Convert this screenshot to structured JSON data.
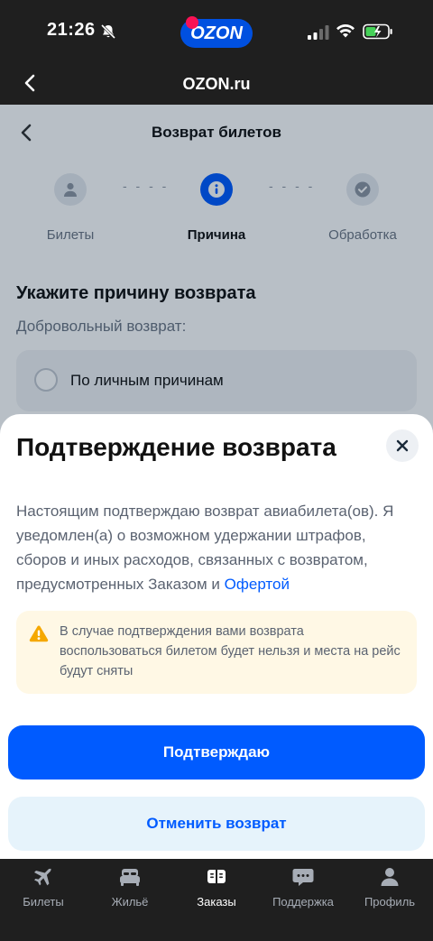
{
  "status_bar": {
    "time": "21:26",
    "app_logo": "OZON"
  },
  "browser": {
    "title": "OZON.ru"
  },
  "page": {
    "title": "Возврат билетов",
    "steps": [
      {
        "label": "Билеты",
        "icon": "user-icon",
        "state": "done"
      },
      {
        "label": "Причина",
        "icon": "info-icon",
        "state": "active"
      },
      {
        "label": "Обработка",
        "icon": "check-icon",
        "state": "pending"
      }
    ],
    "reason": {
      "title": "Укажите причину возврата",
      "subtitle": "Добровольный возврат:",
      "option": "По личным причинам"
    }
  },
  "sheet": {
    "title": "Подтверждение возврата",
    "text": "Настоящим подтверждаю возврат авиабилета(ов). Я уведомлен(а) о возможном удержании штрафов, сборов и иных расходов, связанных с возвратом, предусмотренных Заказом и",
    "link": "Офертой",
    "warning": "В случае подтверждения вами возврата воспользоваться билетом будет нельзя и места на рейс будут сняты",
    "confirm_label": "Подтверждаю",
    "cancel_label": "Отменить возврат"
  },
  "tabs": [
    {
      "label": "Билеты",
      "icon": "plane-icon",
      "active": false
    },
    {
      "label": "Жильё",
      "icon": "bed-icon",
      "active": false
    },
    {
      "label": "Заказы",
      "icon": "book-icon",
      "active": true
    },
    {
      "label": "Поддержка",
      "icon": "chat-icon",
      "active": false
    },
    {
      "label": "Профиль",
      "icon": "profile-icon",
      "active": false
    }
  ],
  "colors": {
    "accent": "#005bff",
    "warning_bg": "#fff8e5",
    "warning_icon": "#f5a800",
    "logo_bg": "#0050e0",
    "logo_dot": "#f91155"
  }
}
